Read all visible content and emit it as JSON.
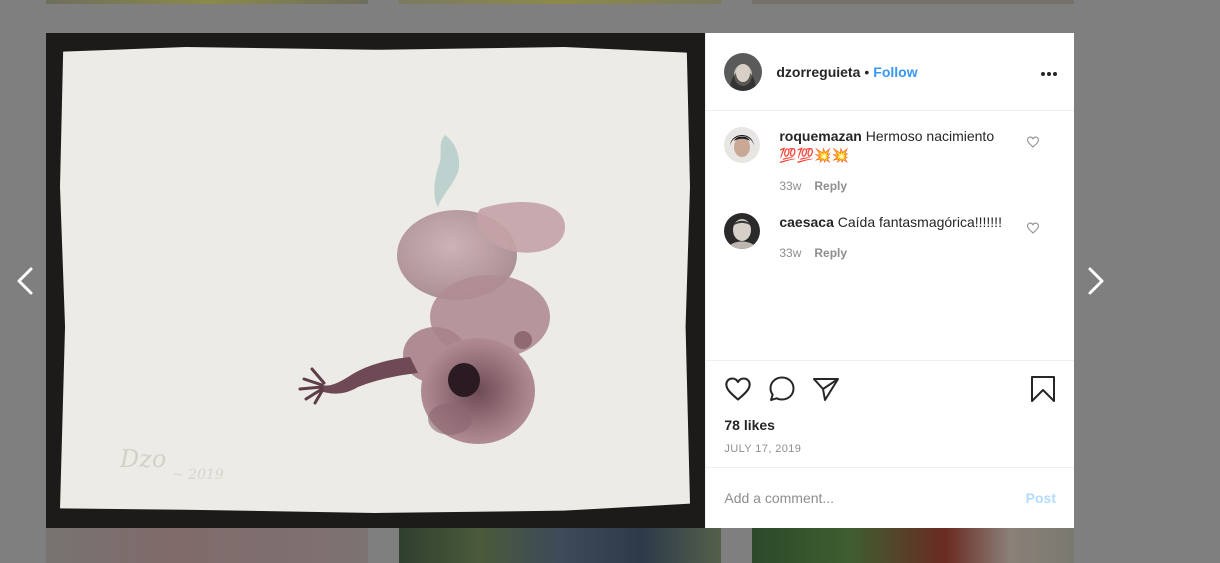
{
  "post": {
    "username": "dzorreguieta",
    "separator": "•",
    "follow_label": "Follow",
    "more_label": "•••",
    "likes": "78 likes",
    "date": "JULY 17, 2019",
    "comment_placeholder": "Add a comment...",
    "post_label": "Post"
  },
  "comments": [
    {
      "username": "roquemazan",
      "text": "Hermoso nacimiento 💯💯💥💥",
      "age": "33w",
      "reply_label": "Reply"
    },
    {
      "username": "caesaca",
      "text": "Caída fantasmagórica!!!!!!!",
      "age": "33w",
      "reply_label": "Reply"
    }
  ],
  "icons": [
    "chevron-left-icon",
    "chevron-right-icon",
    "more-options-icon",
    "heart-icon",
    "comment-icon",
    "share-icon",
    "bookmark-icon"
  ],
  "colors": {
    "follow": "#3897f0",
    "post_disabled": "#b3dbff",
    "overlay": "#7f7f7f"
  }
}
